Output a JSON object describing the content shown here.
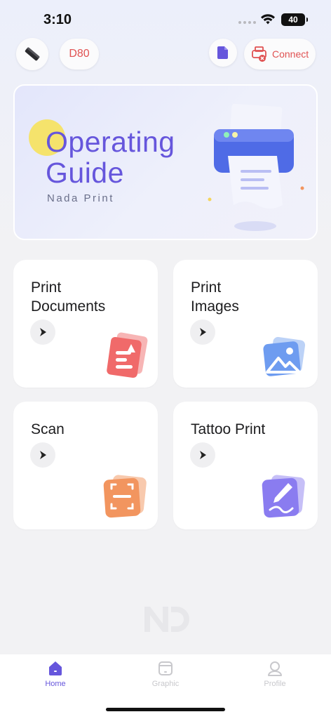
{
  "status_bar": {
    "time": "3:10",
    "battery": "40"
  },
  "toolbar": {
    "device_icon": "printer-device-icon",
    "model": "D80",
    "doc_icon": "document-icon",
    "connect_icon": "printer-disconnected-icon",
    "connect_label": "Connect"
  },
  "banner": {
    "title_line1": "Operating",
    "title_line2": "Guide",
    "subtitle": "Nada Print",
    "illustration": "printer-illustration"
  },
  "cards": [
    {
      "title_line1": "Print",
      "title_line2": "Documents",
      "icon": "document-print-icon",
      "color": "#f06a6a"
    },
    {
      "title_line1": "Print",
      "title_line2": "Images",
      "icon": "image-print-icon",
      "color": "#6e9cf0"
    },
    {
      "title_line1": "Scan",
      "title_line2": "",
      "icon": "scan-icon",
      "color": "#f2955f"
    },
    {
      "title_line1": "Tattoo Print",
      "title_line2": "",
      "icon": "tattoo-pen-icon",
      "color": "#8a7cf0"
    }
  ],
  "watermark": "nd-logo",
  "tabs": [
    {
      "label": "Home",
      "icon": "home-icon",
      "active": true
    },
    {
      "label": "Graphic",
      "icon": "graphic-icon",
      "active": false
    },
    {
      "label": "Profile",
      "icon": "profile-icon",
      "active": false
    }
  ],
  "colors": {
    "accent": "#6656dc",
    "alert": "#e05252",
    "background": "#f2f2f4"
  }
}
